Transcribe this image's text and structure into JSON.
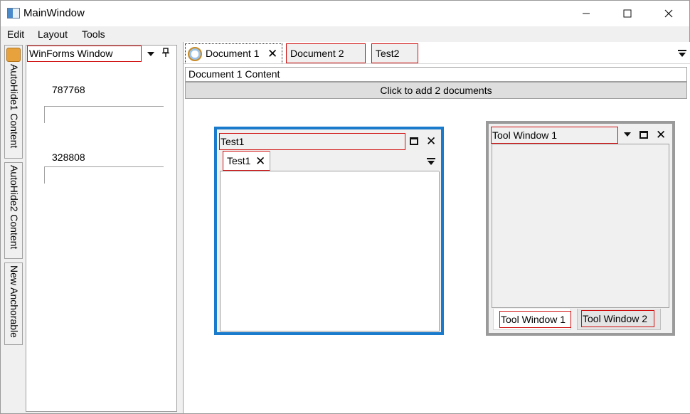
{
  "window": {
    "title": "MainWindow",
    "controls": {
      "minimize": "—",
      "maximize": "☐",
      "close": "✕"
    }
  },
  "menu": [
    "Edit",
    "Layout",
    "Tools"
  ],
  "autohide_tabs": [
    "AutoHide1 Content",
    "AutoHide2 Content",
    "New Anchorable"
  ],
  "left_panel": {
    "title": "WinForms Window",
    "value1": "787768",
    "value2": "328808"
  },
  "documents": {
    "tabs": [
      "Document 1",
      "Document 2",
      "Test2"
    ],
    "active_content_label": "Document 1 Content",
    "add_button": "Click to add 2 documents"
  },
  "float_window": {
    "title": "Test1",
    "tab": "Test1"
  },
  "tool_window": {
    "title": "Tool Window 1",
    "tabs": [
      "Tool Window 1",
      "Tool Window 2"
    ]
  },
  "colors": {
    "accent_blue": "#1a7acb",
    "highlight_red": "#d01010",
    "floating_gray": "#9a9a9a"
  },
  "icons": [
    "app-icon",
    "clock-document-icon",
    "pin-icon",
    "dropdown-icon",
    "maximize-icon",
    "close-icon",
    "tab-overflow-icon"
  ]
}
